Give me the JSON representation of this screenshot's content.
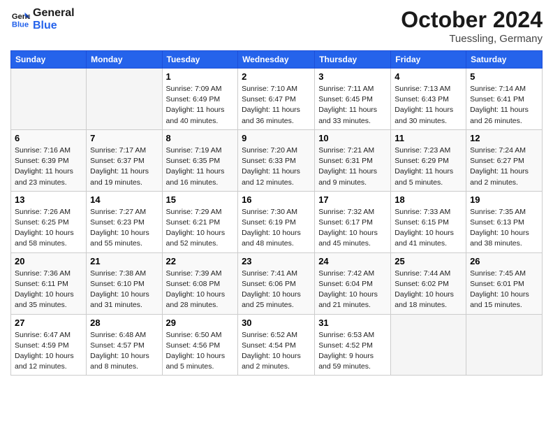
{
  "header": {
    "logo_line1": "General",
    "logo_line2": "Blue",
    "month": "October 2024",
    "location": "Tuessling, Germany"
  },
  "weekdays": [
    "Sunday",
    "Monday",
    "Tuesday",
    "Wednesday",
    "Thursday",
    "Friday",
    "Saturday"
  ],
  "weeks": [
    [
      {
        "day": "",
        "text": ""
      },
      {
        "day": "",
        "text": ""
      },
      {
        "day": "1",
        "text": "Sunrise: 7:09 AM\nSunset: 6:49 PM\nDaylight: 11 hours and 40 minutes."
      },
      {
        "day": "2",
        "text": "Sunrise: 7:10 AM\nSunset: 6:47 PM\nDaylight: 11 hours and 36 minutes."
      },
      {
        "day": "3",
        "text": "Sunrise: 7:11 AM\nSunset: 6:45 PM\nDaylight: 11 hours and 33 minutes."
      },
      {
        "day": "4",
        "text": "Sunrise: 7:13 AM\nSunset: 6:43 PM\nDaylight: 11 hours and 30 minutes."
      },
      {
        "day": "5",
        "text": "Sunrise: 7:14 AM\nSunset: 6:41 PM\nDaylight: 11 hours and 26 minutes."
      }
    ],
    [
      {
        "day": "6",
        "text": "Sunrise: 7:16 AM\nSunset: 6:39 PM\nDaylight: 11 hours and 23 minutes."
      },
      {
        "day": "7",
        "text": "Sunrise: 7:17 AM\nSunset: 6:37 PM\nDaylight: 11 hours and 19 minutes."
      },
      {
        "day": "8",
        "text": "Sunrise: 7:19 AM\nSunset: 6:35 PM\nDaylight: 11 hours and 16 minutes."
      },
      {
        "day": "9",
        "text": "Sunrise: 7:20 AM\nSunset: 6:33 PM\nDaylight: 11 hours and 12 minutes."
      },
      {
        "day": "10",
        "text": "Sunrise: 7:21 AM\nSunset: 6:31 PM\nDaylight: 11 hours and 9 minutes."
      },
      {
        "day": "11",
        "text": "Sunrise: 7:23 AM\nSunset: 6:29 PM\nDaylight: 11 hours and 5 minutes."
      },
      {
        "day": "12",
        "text": "Sunrise: 7:24 AM\nSunset: 6:27 PM\nDaylight: 11 hours and 2 minutes."
      }
    ],
    [
      {
        "day": "13",
        "text": "Sunrise: 7:26 AM\nSunset: 6:25 PM\nDaylight: 10 hours and 58 minutes."
      },
      {
        "day": "14",
        "text": "Sunrise: 7:27 AM\nSunset: 6:23 PM\nDaylight: 10 hours and 55 minutes."
      },
      {
        "day": "15",
        "text": "Sunrise: 7:29 AM\nSunset: 6:21 PM\nDaylight: 10 hours and 52 minutes."
      },
      {
        "day": "16",
        "text": "Sunrise: 7:30 AM\nSunset: 6:19 PM\nDaylight: 10 hours and 48 minutes."
      },
      {
        "day": "17",
        "text": "Sunrise: 7:32 AM\nSunset: 6:17 PM\nDaylight: 10 hours and 45 minutes."
      },
      {
        "day": "18",
        "text": "Sunrise: 7:33 AM\nSunset: 6:15 PM\nDaylight: 10 hours and 41 minutes."
      },
      {
        "day": "19",
        "text": "Sunrise: 7:35 AM\nSunset: 6:13 PM\nDaylight: 10 hours and 38 minutes."
      }
    ],
    [
      {
        "day": "20",
        "text": "Sunrise: 7:36 AM\nSunset: 6:11 PM\nDaylight: 10 hours and 35 minutes."
      },
      {
        "day": "21",
        "text": "Sunrise: 7:38 AM\nSunset: 6:10 PM\nDaylight: 10 hours and 31 minutes."
      },
      {
        "day": "22",
        "text": "Sunrise: 7:39 AM\nSunset: 6:08 PM\nDaylight: 10 hours and 28 minutes."
      },
      {
        "day": "23",
        "text": "Sunrise: 7:41 AM\nSunset: 6:06 PM\nDaylight: 10 hours and 25 minutes."
      },
      {
        "day": "24",
        "text": "Sunrise: 7:42 AM\nSunset: 6:04 PM\nDaylight: 10 hours and 21 minutes."
      },
      {
        "day": "25",
        "text": "Sunrise: 7:44 AM\nSunset: 6:02 PM\nDaylight: 10 hours and 18 minutes."
      },
      {
        "day": "26",
        "text": "Sunrise: 7:45 AM\nSunset: 6:01 PM\nDaylight: 10 hours and 15 minutes."
      }
    ],
    [
      {
        "day": "27",
        "text": "Sunrise: 6:47 AM\nSunset: 4:59 PM\nDaylight: 10 hours and 12 minutes."
      },
      {
        "day": "28",
        "text": "Sunrise: 6:48 AM\nSunset: 4:57 PM\nDaylight: 10 hours and 8 minutes."
      },
      {
        "day": "29",
        "text": "Sunrise: 6:50 AM\nSunset: 4:56 PM\nDaylight: 10 hours and 5 minutes."
      },
      {
        "day": "30",
        "text": "Sunrise: 6:52 AM\nSunset: 4:54 PM\nDaylight: 10 hours and 2 minutes."
      },
      {
        "day": "31",
        "text": "Sunrise: 6:53 AM\nSunset: 4:52 PM\nDaylight: 9 hours and 59 minutes."
      },
      {
        "day": "",
        "text": ""
      },
      {
        "day": "",
        "text": ""
      }
    ]
  ]
}
